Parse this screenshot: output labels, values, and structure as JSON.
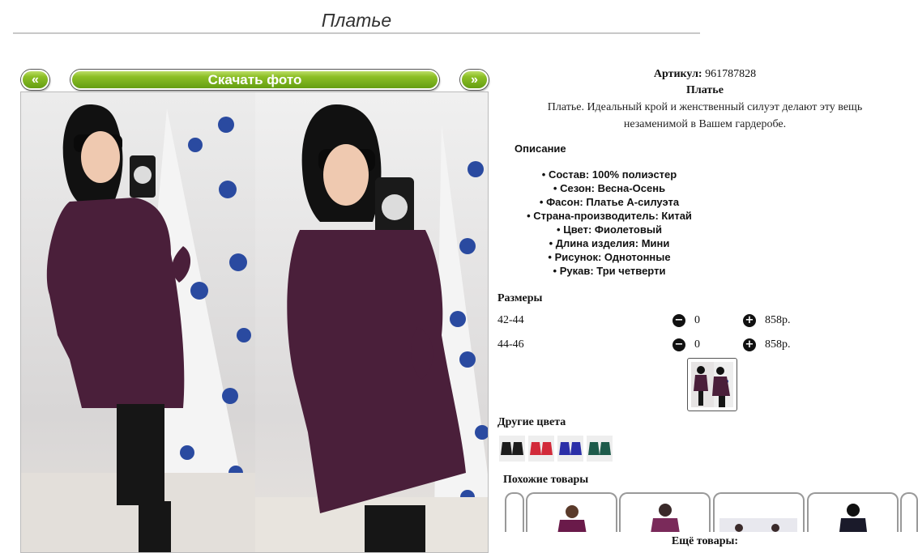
{
  "page": {
    "title": "Платье"
  },
  "gallery": {
    "prev_label": "«",
    "download_label": "Скачать фото",
    "next_label": "»"
  },
  "product": {
    "article_label": "Артикул:",
    "article_value": "961787828",
    "name": "Платье",
    "description": "Платье. Идеальный крой и женственный силуэт делают эту вещь незаменимой в Вашем гардеробе."
  },
  "specs": {
    "heading": "Описание",
    "items": [
      "Состав: 100% полиэстер",
      "Сезон: Весна-Осень",
      "Фасон: Платье А-силуэта",
      "Страна-производитель: Китай",
      "Цвет: Фиолетовый",
      "Длина изделия: Мини",
      "Рисунок: Однотонные",
      "Рукав: Три четверти"
    ]
  },
  "sizes": {
    "heading": "Размеры",
    "minus_icon": "−",
    "plus_icon": "+",
    "rows": [
      {
        "size": "42-44",
        "qty": "0",
        "price": "858р."
      },
      {
        "size": "44-46",
        "qty": "0",
        "price": "858р."
      }
    ]
  },
  "colors": {
    "heading": "Другие цвета"
  },
  "similar": {
    "heading": "Похожие товары"
  },
  "more": {
    "label": "Ещё товары:"
  },
  "palette": {
    "accent_green": "#7cb32a",
    "dress_purple": "#4a1f3a"
  }
}
